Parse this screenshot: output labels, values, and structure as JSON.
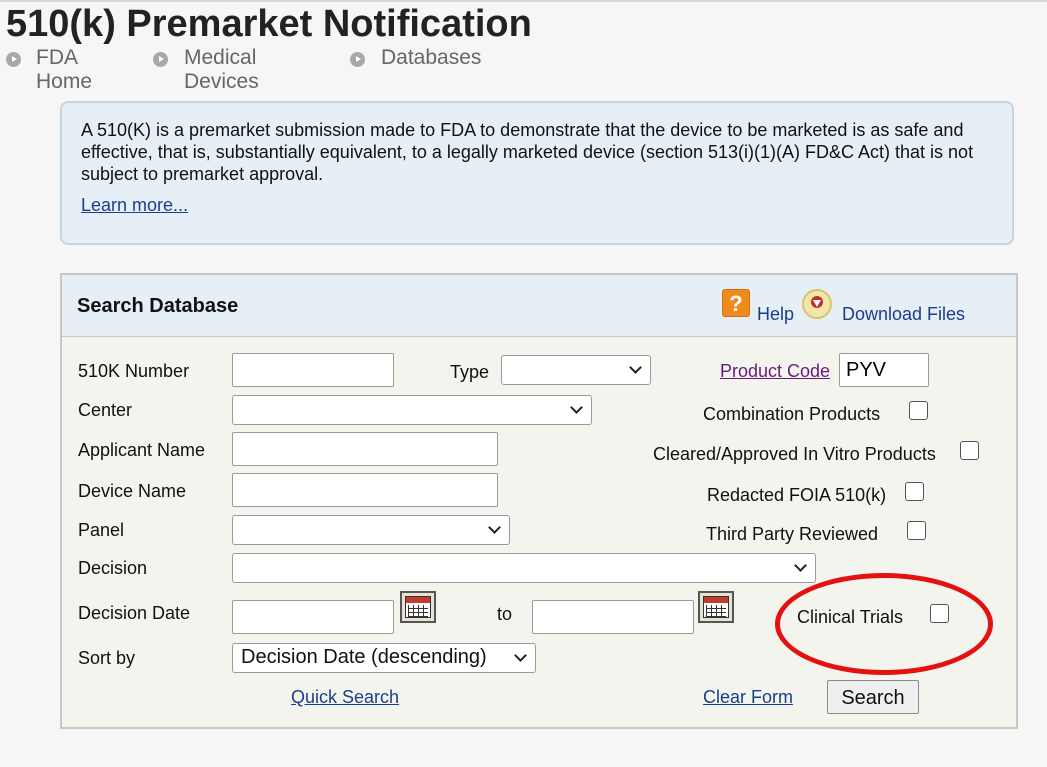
{
  "page": {
    "title": "510(k) Premarket Notification",
    "breadcrumbs": [
      "FDA Home",
      "Medical Devices",
      "Databases"
    ]
  },
  "info": {
    "text": "A 510(K) is a premarket submission made to FDA to demonstrate that the device to be marketed is as safe and effective, that is, substantially equivalent, to a legally marketed device (section 513(i)(1)(A) FD&C Act) that is not subject to premarket approval.",
    "learn_more": "Learn more..."
  },
  "search": {
    "title": "Search Database",
    "help": "Help",
    "download": "Download Files",
    "fields": {
      "number_label": "510K Number",
      "number_value": "",
      "type_label": "Type",
      "type_value": "",
      "product_code_label": "Product Code",
      "product_code_value": "PYV",
      "center_label": "Center",
      "center_value": "",
      "applicant_label": "Applicant Name",
      "applicant_value": "",
      "device_label": "Device Name",
      "device_value": "",
      "panel_label": "Panel",
      "panel_value": "",
      "decision_label": "Decision",
      "decision_value": "",
      "decision_date_label": "Decision Date",
      "date_to_label": "to",
      "date_from_value": "",
      "date_to_value": "",
      "sort_label": "Sort by",
      "sort_value": "Decision Date (descending)"
    },
    "checkboxes": {
      "combination": "Combination Products",
      "cleared_ivd": "Cleared/Approved In Vitro Products",
      "redacted_foia": "Redacted FOIA 510(k)",
      "third_party": "Third Party Reviewed",
      "clinical_trials": "Clinical Trials"
    },
    "quick_search": "Quick Search",
    "clear_form": "Clear Form",
    "search_button": "Search"
  },
  "colors": {
    "highlight_ellipse": "#e3110f",
    "link": "#1a3e8a",
    "visited_link": "#6a1b7a",
    "info_bg": "#e6eef6"
  }
}
